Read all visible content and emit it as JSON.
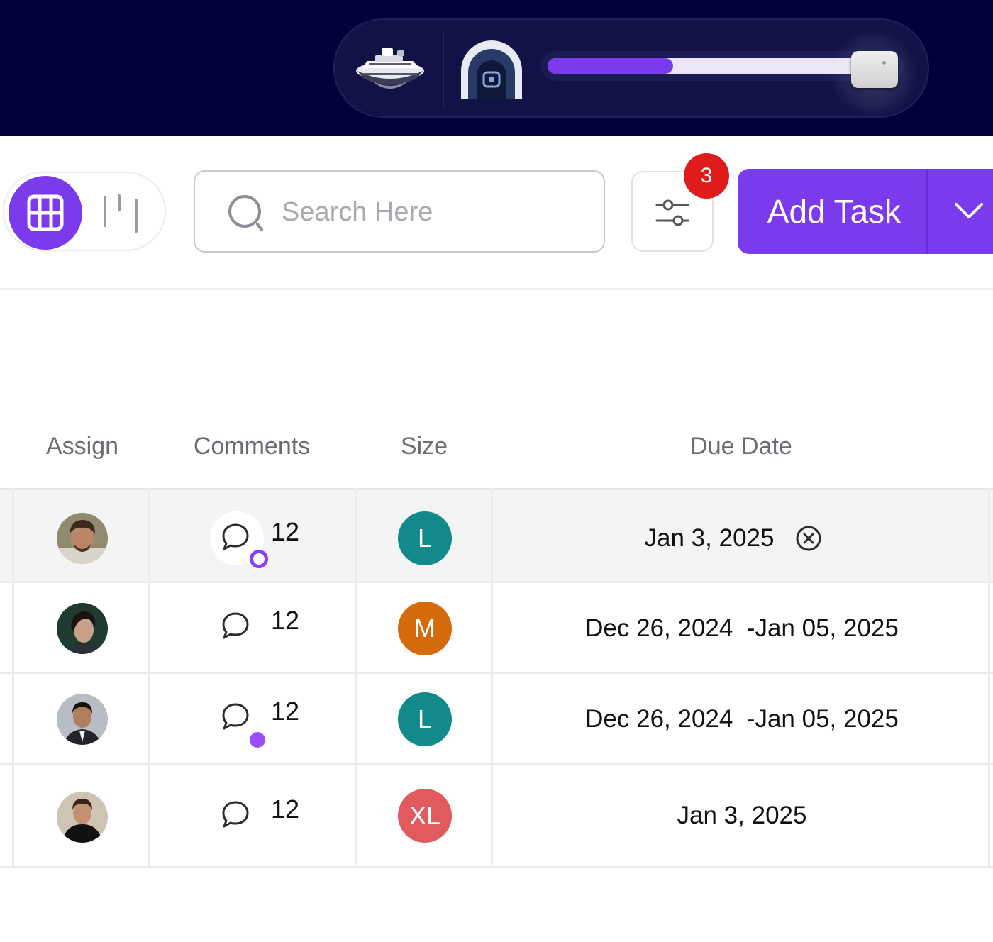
{
  "game_bar": {
    "progress_percent": 36,
    "icons": [
      "ship-icon",
      "portal-icon",
      "slider-knob"
    ]
  },
  "toolbar": {
    "view_modes": [
      "grid-view",
      "board-view"
    ],
    "active_view": "grid-view",
    "search": {
      "placeholder": "Search Here",
      "value": ""
    },
    "filter_count": "3",
    "add_task_label": "Add Task"
  },
  "table": {
    "headers": {
      "assign": "Assign",
      "comments": "Comments",
      "size": "Size",
      "due_date": "Due Date"
    },
    "rows": [
      {
        "avatar": "avatar-1",
        "comments": "12",
        "comment_dot": "ring",
        "size": "L",
        "size_color": "#12898a",
        "due": "Jan 3, 2025",
        "clearable": true
      },
      {
        "avatar": "avatar-2",
        "comments": "12",
        "comment_dot": "none",
        "size": "M",
        "size_color": "#d46a0c",
        "due": "Dec 26, 2024  -Jan 05, 2025",
        "clearable": false
      },
      {
        "avatar": "avatar-3",
        "comments": "12",
        "comment_dot": "filled",
        "size": "L",
        "size_color": "#12898a",
        "due": "Dec 26, 2024  -Jan 05, 2025",
        "clearable": false
      },
      {
        "avatar": "avatar-4",
        "comments": "12",
        "comment_dot": "none",
        "size": "XL",
        "size_color": "#e05a5e",
        "due": "Jan 3, 2025",
        "clearable": false
      }
    ]
  },
  "colors": {
    "accent": "#7c3aed",
    "banner": "#030238",
    "badge": "#e01b1b"
  }
}
